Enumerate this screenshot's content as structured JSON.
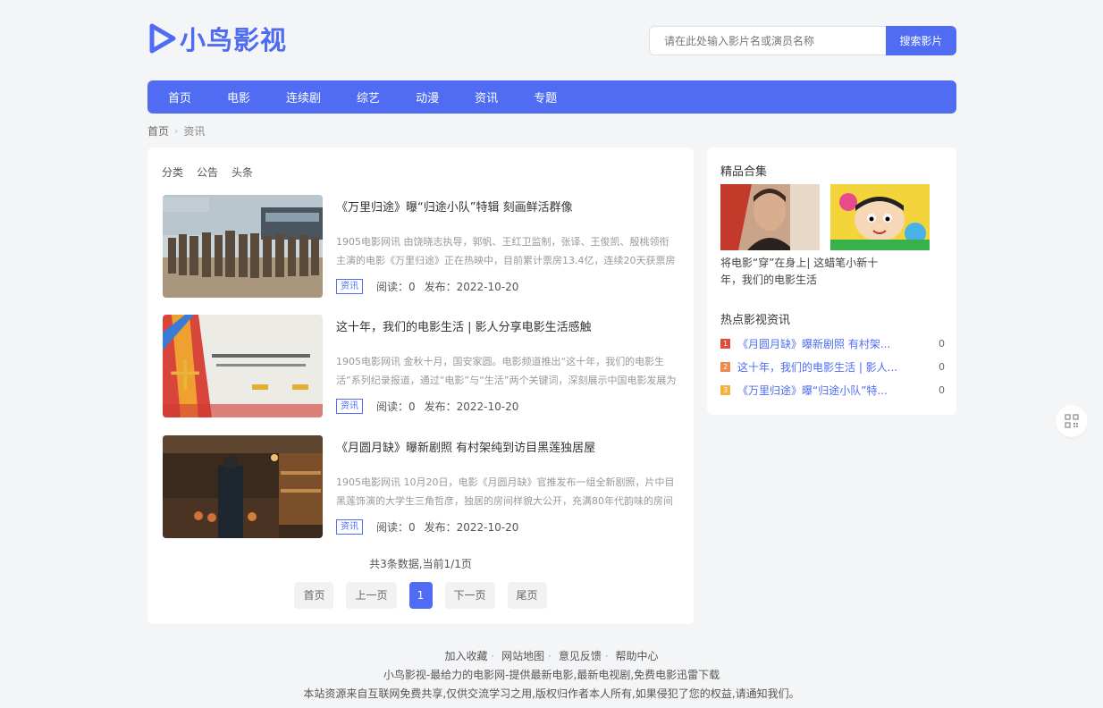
{
  "brand": {
    "name": "小鸟影视",
    "color": "#4f6cf2",
    "logo_icon": "play-triangle-icon"
  },
  "search": {
    "placeholder": "请在此处输入影片名或演员名称",
    "button": "搜索影片"
  },
  "nav": [
    "首页",
    "电影",
    "连续剧",
    "综艺",
    "动漫",
    "资讯",
    "专题"
  ],
  "breadcrumb": {
    "home": "首页",
    "current": "资讯"
  },
  "categories": [
    "分类",
    "公告",
    "头条"
  ],
  "articles": [
    {
      "title": "《万里归途》曝“归途小队”特辑 刻画鲜活群像",
      "desc": "1905电影网讯 由饶晓志执导，郭帆、王红卫监制，张译、王俊凯、殷桃领衔主演的电影《万里归途》正在热映中，目前累计票房13.4亿，连续20天获票房日冠。",
      "tag": "资讯",
      "read": "阅读：0",
      "date": "发布：2022-10-20"
    },
    {
      "title": "这十年，我们的电影生活 | 影人分享电影生活感触",
      "desc": "1905电影网讯 金秋十月，国安家圆。电影频道推出“这十年，我们的电影生活”系列纪录报道，通过“电影”与“生活”两个关键词，深刻展示中国电影发展为",
      "tag": "资讯",
      "read": "阅读：0",
      "date": "发布：2022-10-20"
    },
    {
      "title": "《月圆月缺》曝新剧照 有村架纯到访目黑莲独居屋",
      "desc": "1905电影网讯 10月20日，电影《月圆月缺》官推发布一组全新剧照，片中目黑莲饰演的大学生三角哲彦，独居的房间样貌大公开，充满80年代韵味的房间氛围",
      "tag": "资讯",
      "read": "阅读：0",
      "date": "发布：2022-10-20"
    }
  ],
  "pagination": {
    "summary": "共3条数据,当前1/1页",
    "first": "首页",
    "prev": "上一页",
    "current": "1",
    "next": "下一页",
    "last": "尾页"
  },
  "sidebar": {
    "album_heading": "精品合集",
    "album_caption": "将电影“穿”在身上| 这蜡笔小新十年，我们的电影生活",
    "hot_heading": "热点影视资讯",
    "hot_items": [
      {
        "rank": "1",
        "title": "《月圆月缺》曝新剧照 有村架...",
        "views": "0",
        "color": "#e04b3a"
      },
      {
        "rank": "2",
        "title": "这十年，我们的电影生活 | 影人...",
        "views": "0",
        "color": "#f08a4b"
      },
      {
        "rank": "3",
        "title": "《万里归途》曝“归途小队”特...",
        "views": "0",
        "color": "#f0b43c"
      }
    ]
  },
  "footer": {
    "links": [
      "加入收藏",
      "网站地图",
      "意见反馈",
      "帮助中心"
    ],
    "separator": "·",
    "line1": "小鸟影视-最给力的电影网-提供最新电影,最新电视剧,免费电影迅雷下载",
    "line2": "本站资源来自互联网免费共享,仅供交流学习之用,版权归作者本人所有,如果侵犯了您的权益,请通知我们。"
  }
}
